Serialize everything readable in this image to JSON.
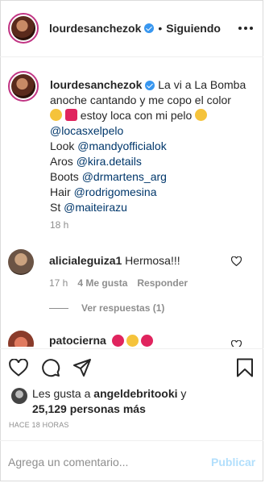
{
  "header": {
    "username": "lourdesanchezok",
    "dot": "•",
    "follow_status": "Siguiendo",
    "more_icon": "more-icon"
  },
  "caption": {
    "username": "lourdesanchezok",
    "line1": "La vi a La Bomba anoche cantando y me copo el color",
    "line2": "estoy loca con mi pelo",
    "tag1": "@locasxelpelo",
    "look_label": "Look",
    "look_tag": "@mandyofficialok",
    "aros_label": "Aros",
    "aros_tag": "@kira.details",
    "boots_label": "Boots",
    "boots_tag": "@drmartens_arg",
    "hair_label": "Hair",
    "hair_tag": "@rodrigomesina",
    "st_label": "St",
    "st_tag": "@maiteirazu",
    "time": "18 h"
  },
  "comments": [
    {
      "username": "alicialeguiza1",
      "text": "Hermosa!!!",
      "time": "17 h",
      "likes": "4 Me gusta",
      "reply": "Responder",
      "view_replies": "Ver respuestas (1)"
    },
    {
      "username": "patocierna"
    }
  ],
  "actions": {
    "like_icon": "heart-icon",
    "comment_icon": "comment-icon",
    "share_icon": "share-icon",
    "save_icon": "bookmark-icon"
  },
  "likes": {
    "prefix": "Les gusta a",
    "user": "angeldebritooki",
    "conj": "y",
    "others": "25,129 personas más"
  },
  "timestamp": "HACE 18 HORAS",
  "composer": {
    "placeholder": "Agrega un comentario...",
    "publish": "Publicar"
  },
  "colors": {
    "link": "#00376b",
    "verified": "#3897f0",
    "publish_disabled": "#b2dffc",
    "muted": "#8e8e8e"
  }
}
